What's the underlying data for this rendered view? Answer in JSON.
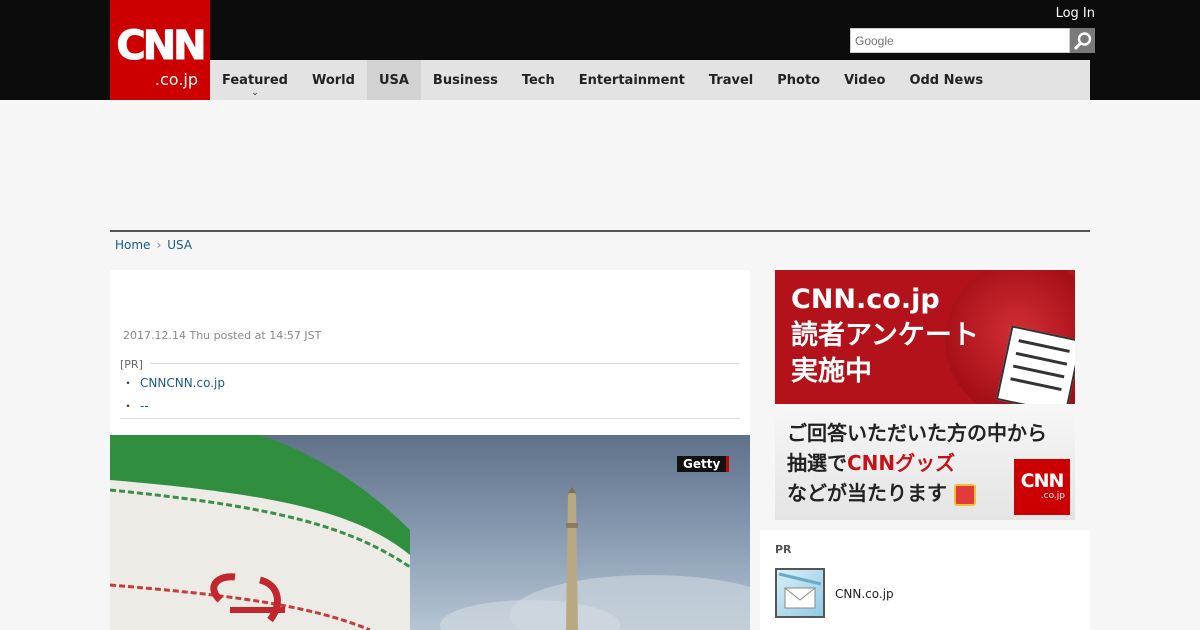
{
  "header": {
    "logo": {
      "main": "CNN",
      "sub": ".co.jp"
    },
    "login_label": "Log In",
    "search": {
      "placeholder": "Google"
    }
  },
  "nav": {
    "items": [
      {
        "label": "Featured",
        "active": false,
        "has_dropdown": true
      },
      {
        "label": "World",
        "active": false
      },
      {
        "label": "USA",
        "active": true
      },
      {
        "label": "Business",
        "active": false
      },
      {
        "label": "Tech",
        "active": false
      },
      {
        "label": "Entertainment",
        "active": false
      },
      {
        "label": "Travel",
        "active": false
      },
      {
        "label": "Photo",
        "active": false
      },
      {
        "label": "Video",
        "active": false
      },
      {
        "label": "Odd News",
        "active": false
      }
    ]
  },
  "breadcrumb": {
    "home": "Home",
    "section": "USA"
  },
  "article": {
    "posted": "2017.12.14 Thu posted at 14:57 JST",
    "pr_label": "[PR]",
    "pr_links": [
      "CNNCNN.co.jp",
      "--"
    ],
    "hero_credit": "Getty"
  },
  "survey_ad": {
    "title_lines": [
      "CNN.co.jp",
      "読者アンケート",
      "実施中"
    ],
    "sub_line1": "ご回答いただいた方の中から",
    "sub_line2_prefix": "抽選で",
    "sub_line2_highlight": "CNNグッズ",
    "sub_line3": "などが当たります",
    "logo_main": "CNN",
    "logo_sub": ".co.jp"
  },
  "pr_box": {
    "label": "PR",
    "item_text": "CNN.co.jp"
  },
  "colors": {
    "brand_red": "#cc0000",
    "header_bg": "#0c0c0c",
    "nav_bg": "#e3e3e3",
    "link": "#1a5a8a"
  }
}
